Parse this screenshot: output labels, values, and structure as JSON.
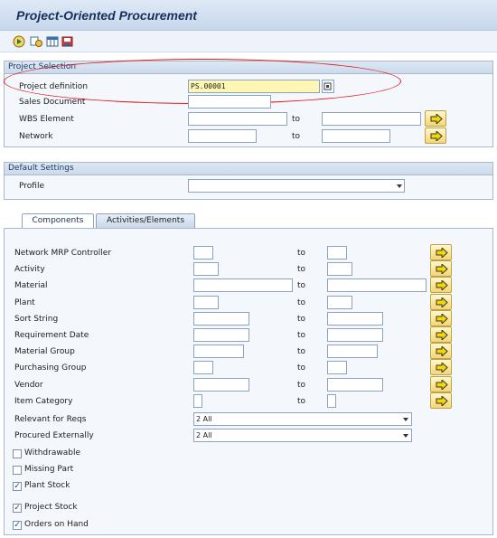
{
  "app": {
    "title": "Project-Oriented Procurement"
  },
  "toolbar": {
    "icons": [
      "execute-icon",
      "variant-icon",
      "data-browser-icon",
      "save-variant-icon"
    ]
  },
  "project_selection": {
    "header": "Project Selection",
    "project_definition": {
      "label": "Project definition",
      "value": "PS.00001"
    },
    "sales_document": {
      "label": "Sales Document",
      "value": ""
    },
    "wbs_element": {
      "label": "WBS Element",
      "to_label": "to"
    },
    "network": {
      "label": "Network",
      "to_label": "to"
    }
  },
  "default_settings": {
    "header": "Default Settings",
    "profile": {
      "label": "Profile",
      "value": ""
    }
  },
  "tabs": [
    {
      "label": "Components",
      "active": true
    },
    {
      "label": "Activities/Elements",
      "active": false
    }
  ],
  "components": {
    "to_label": "to",
    "rows": [
      {
        "label": "Network MRP Controller"
      },
      {
        "label": "Activity"
      },
      {
        "label": "Material"
      },
      {
        "label": "Plant"
      },
      {
        "label": "Sort String"
      },
      {
        "label": "Requirement Date"
      },
      {
        "label": "Material Group"
      },
      {
        "label": "Purchasing Group"
      },
      {
        "label": "Vendor"
      },
      {
        "label": "Item Category"
      }
    ],
    "relevant_for_reqs": {
      "label": "Relevant for Reqs",
      "value": "2 All"
    },
    "procured_externally": {
      "label": "Procured Externally",
      "value": "2 All"
    },
    "checkboxes": [
      {
        "label": "Withdrawable",
        "checked": false
      },
      {
        "label": "Missing Part",
        "checked": false
      },
      {
        "label": "Plant Stock",
        "checked": true
      },
      {
        "label": "Project Stock",
        "checked": true
      },
      {
        "label": "Orders on Hand",
        "checked": true
      }
    ]
  },
  "colors": {
    "highlight_ellipse": "#e01818",
    "required_field": "#fff6b3"
  }
}
